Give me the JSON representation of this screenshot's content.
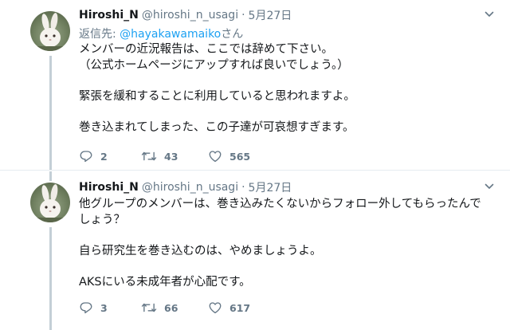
{
  "tweets": [
    {
      "display_name": "Hiroshi_N",
      "handle": "@hiroshi_n_usagi",
      "separator": "·",
      "date": "5月27日",
      "reply_prefix": "返信先: ",
      "reply_mention": "@hayakawamaiko",
      "reply_suffix": "さん",
      "lines": [
        "メンバーの近況報告は、ここでは辞めて下さい。",
        "（公式ホームページにアップすれば良いでしょう。）",
        "",
        "緊張を緩和することに利用していると思われますよ。",
        "",
        "巻き込まれてしまった、この子達が可哀想すぎます。"
      ],
      "reply_count": "2",
      "retweet_count": "43",
      "like_count": "565"
    },
    {
      "display_name": "Hiroshi_N",
      "handle": "@hiroshi_n_usagi",
      "separator": "·",
      "date": "5月27日",
      "lines": [
        "他グループのメンバーは、巻き込みたくないからフォロー外してもらったんで",
        "しょう？",
        "",
        "自ら研究生を巻き込むのは、やめましょうよ。",
        "",
        "AKSにいる未成年者が心配です。"
      ],
      "reply_count": "3",
      "retweet_count": "66",
      "like_count": "617"
    }
  ],
  "colors": {
    "link": "#1da1f2",
    "secondary_text": "#657786",
    "thread_line": "#c4cfd6"
  },
  "icons": [
    "rabbit-avatar",
    "chevron-down-icon",
    "reply-icon",
    "retweet-icon",
    "like-icon"
  ]
}
